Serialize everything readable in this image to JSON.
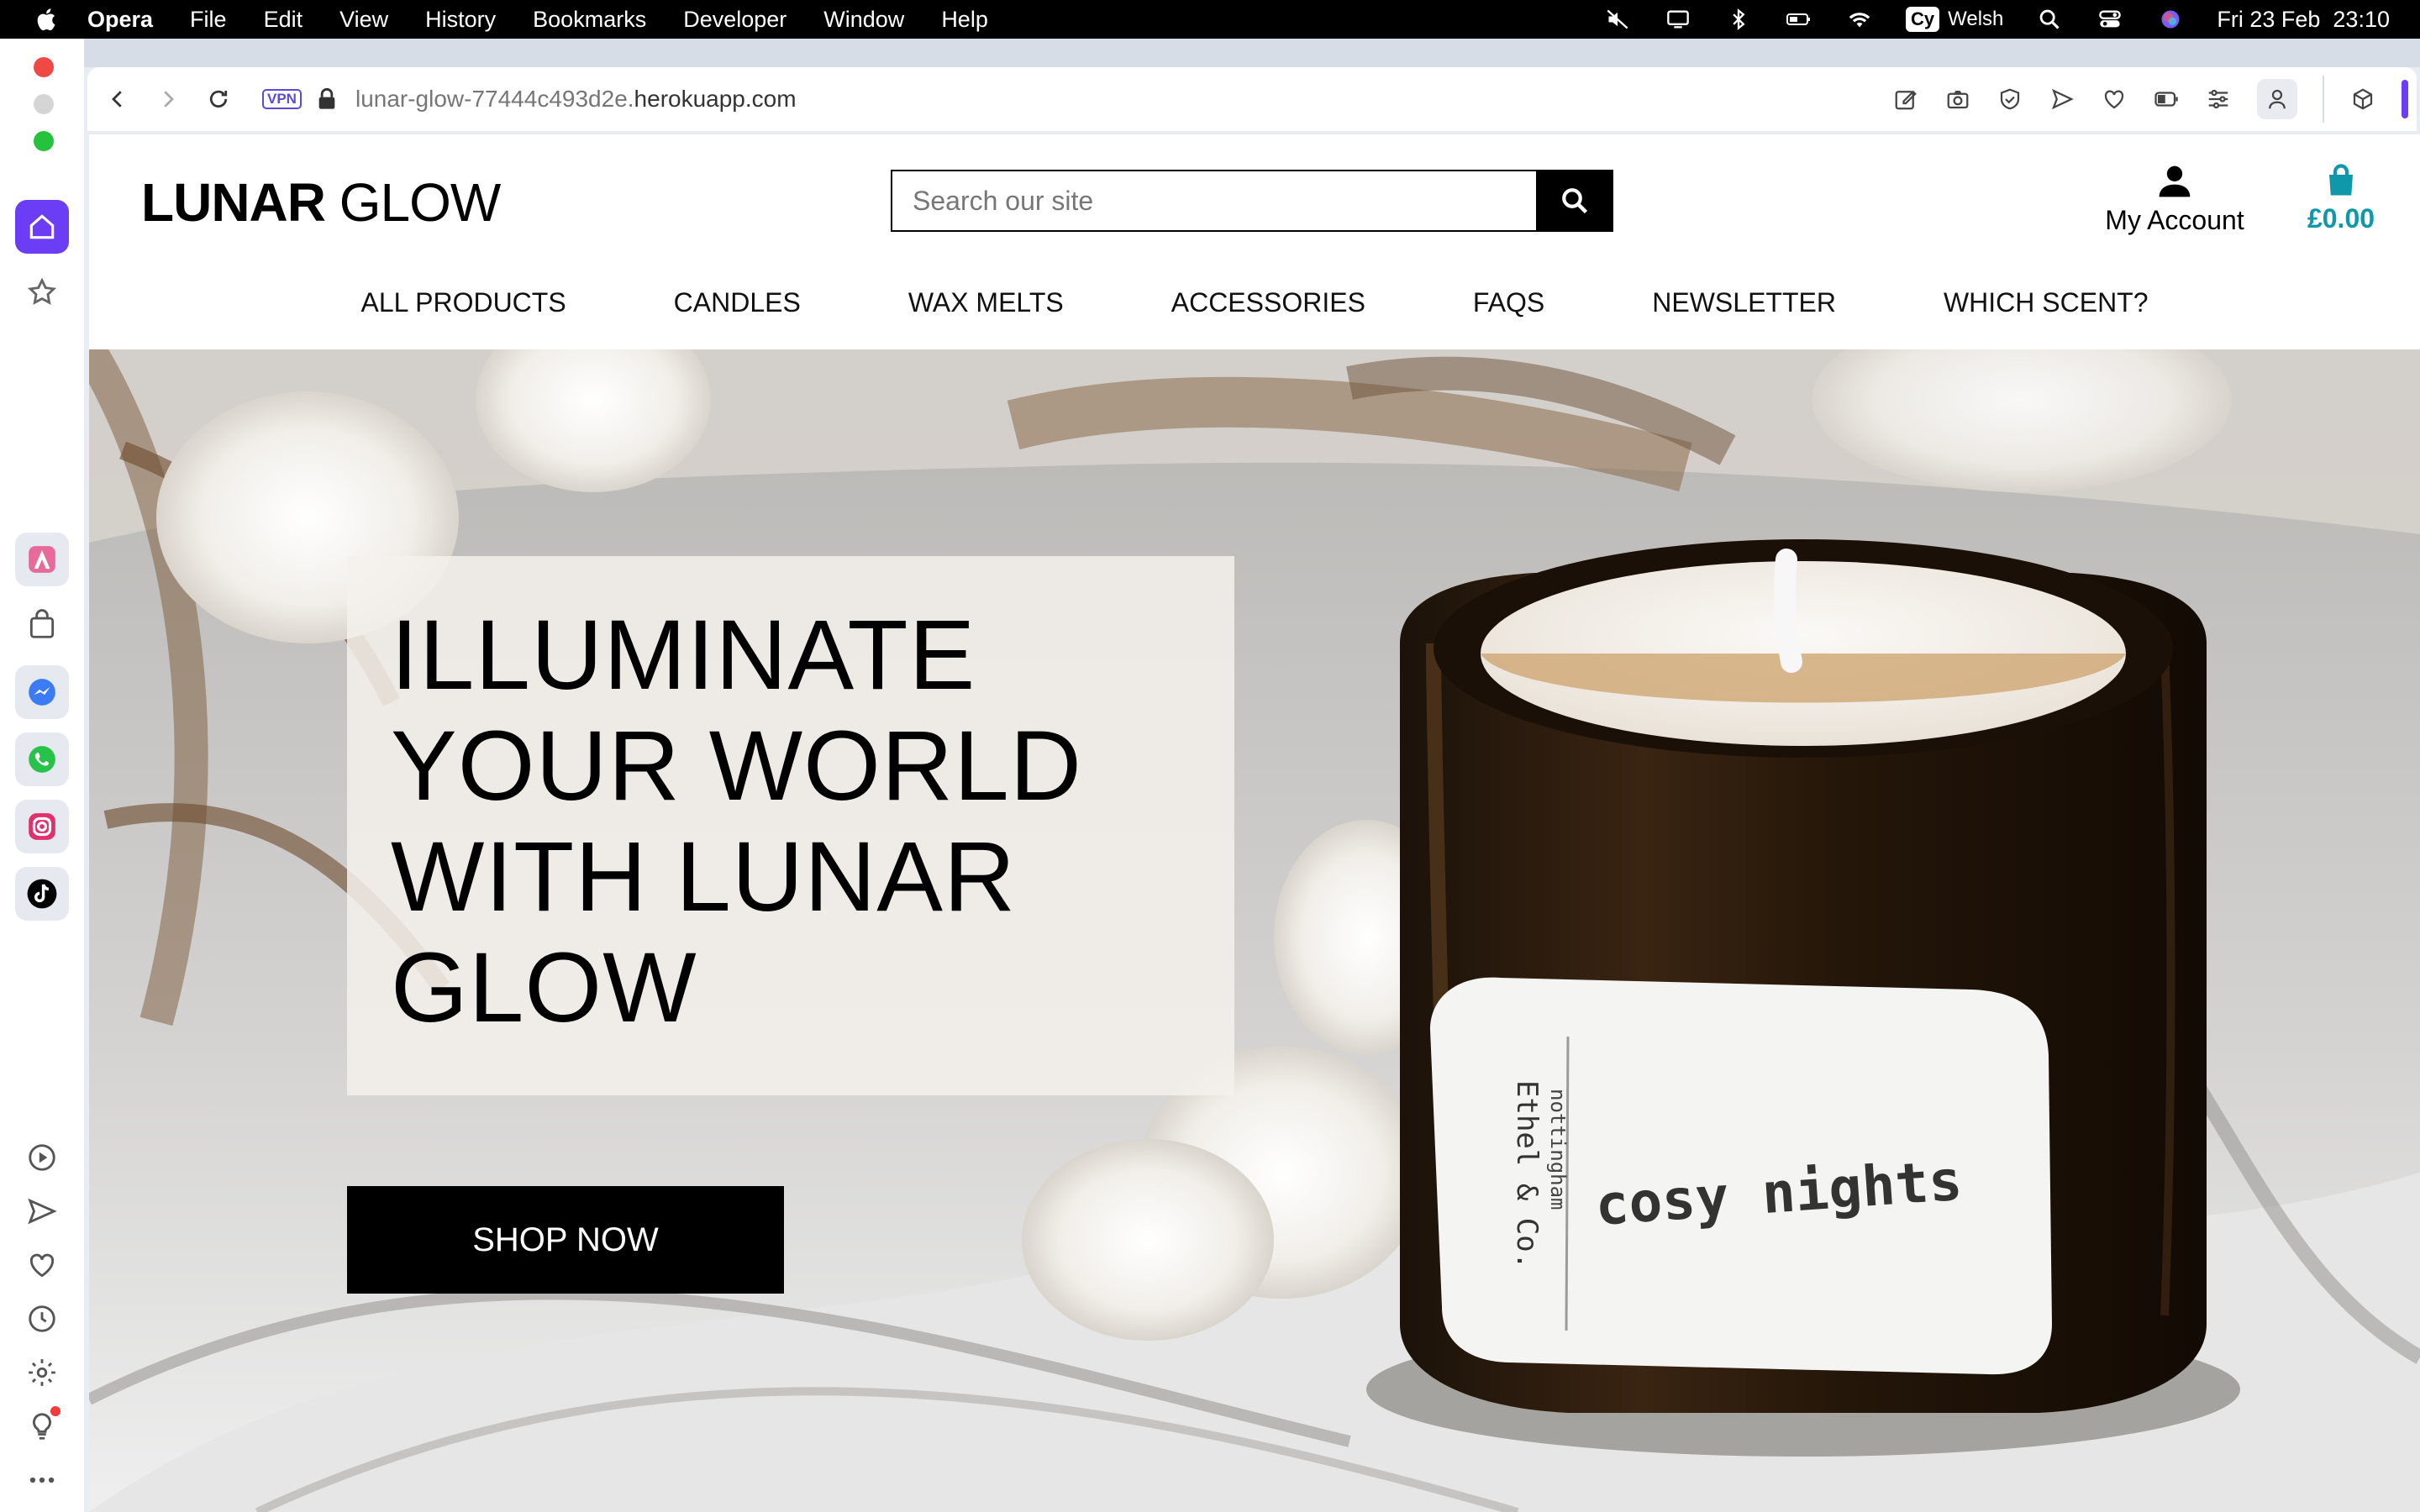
{
  "menubar": {
    "app_name": "Opera",
    "items": [
      "File",
      "Edit",
      "View",
      "History",
      "Bookmarks",
      "Developer",
      "Window",
      "Help"
    ],
    "input_source": "Welsh",
    "input_badge": "Cy",
    "datetime": "Fri 23 Feb  23:10"
  },
  "browser": {
    "vpn_label": "VPN",
    "url_prefix": "lunar-glow-77444c493d2e.",
    "url_domain": "herokuapp.com",
    "accent_color": "#6b3df5"
  },
  "site": {
    "logo_bold": "LUNAR",
    "logo_light": " GLOW",
    "search_placeholder": "Search our site",
    "account_label": "My Account",
    "bag_total": "£0.00",
    "accent_color": "#0f98a7",
    "nav": [
      "ALL PRODUCTS",
      "CANDLES",
      "WAX MELTS",
      "ACCESSORIES",
      "FAQS",
      "NEWSLETTER",
      "WHICH SCENT?"
    ]
  },
  "hero": {
    "headline": "ILLUMINATE YOUR WORLD WITH LUNAR GLOW",
    "cta_label": "SHOP NOW",
    "candle_label": "cosy nights",
    "candle_maker": "Ethel & Co.",
    "candle_city": "nottingham"
  }
}
